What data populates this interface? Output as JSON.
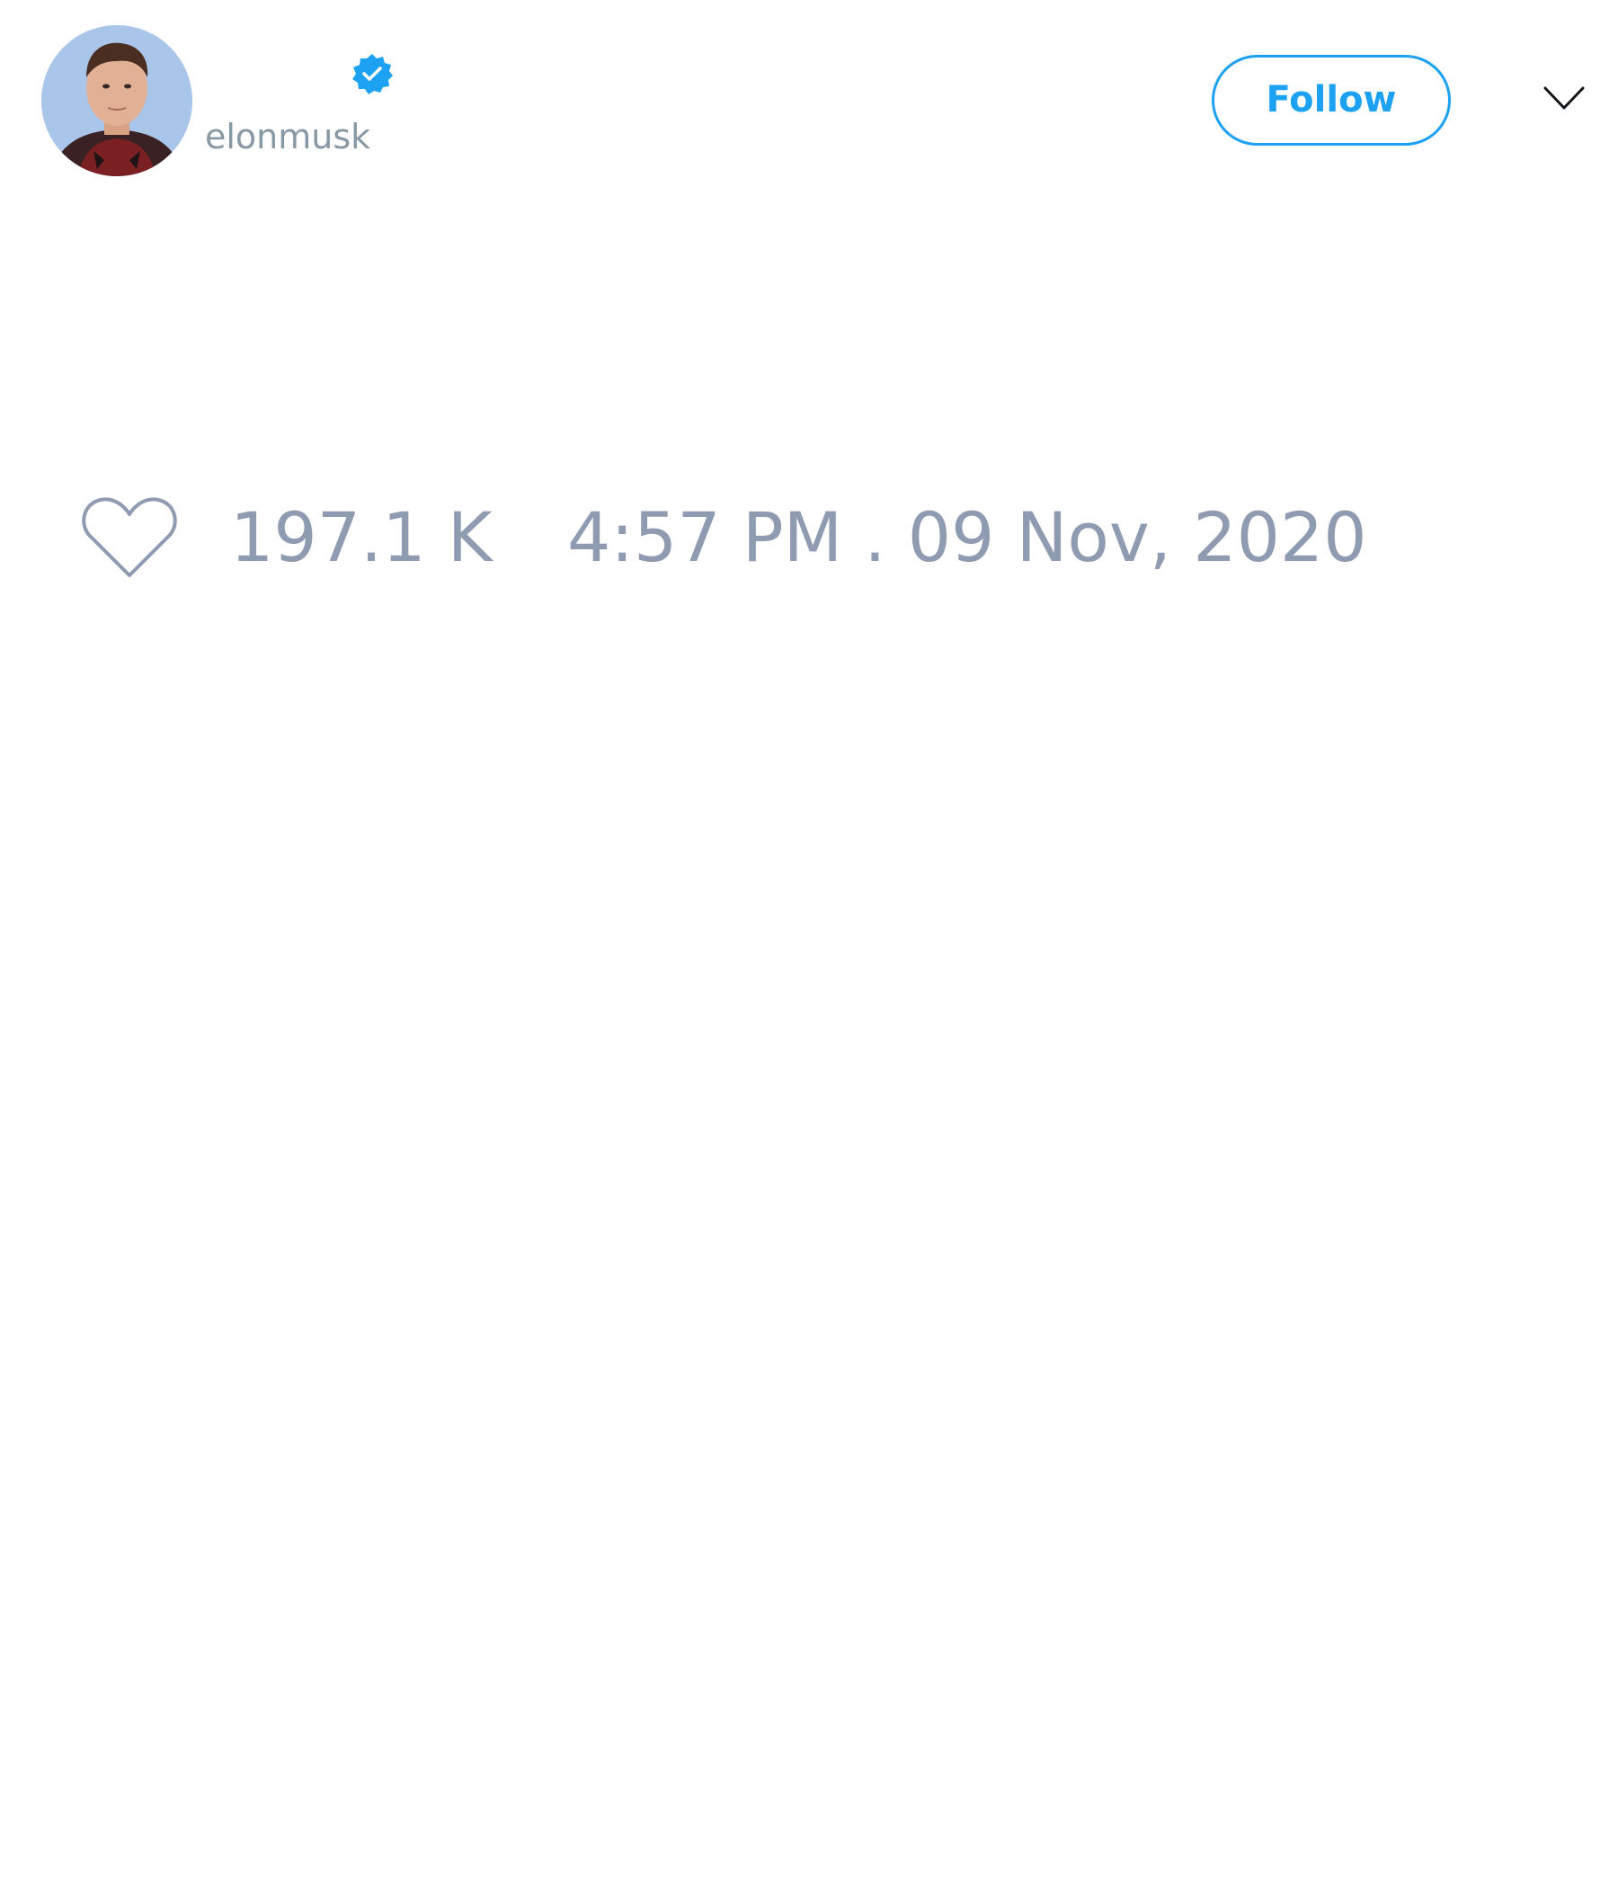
{
  "tweet": {
    "author": {
      "display_name": "",
      "handle": "elonmusk",
      "verified": true,
      "avatar_icon": "profile-photo"
    },
    "follow_label": "Follow",
    "menu_icon": "chevron-down-icon",
    "likes": {
      "icon": "heart-outline-icon",
      "count": "197.1 K"
    },
    "timestamp": "4:57 PM . 09 Nov, 2020"
  },
  "colors": {
    "accent": "#1da1f2",
    "muted_text": "#8f9bb0",
    "handle_text": "#8899a6",
    "background": "#ffffff"
  }
}
